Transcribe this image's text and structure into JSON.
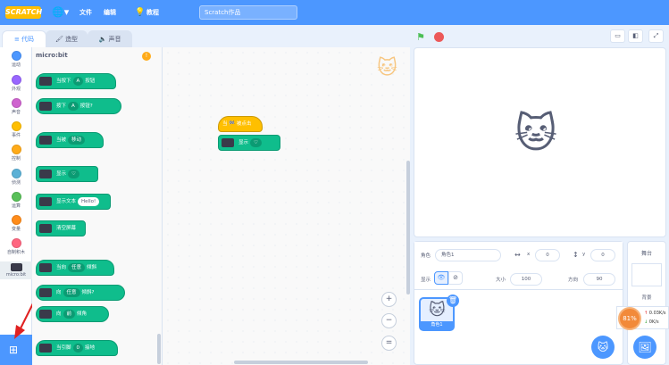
{
  "menubar": {
    "logo": "SCRATCH",
    "file": "文件",
    "edit": "编辑",
    "tutorials": "教程",
    "project_title": "Scratch作品"
  },
  "tabs": {
    "code": "代码",
    "costumes": "造型",
    "sounds": "声音"
  },
  "categories": [
    {
      "label": "运动",
      "color": "#4c97ff"
    },
    {
      "label": "外观",
      "color": "#9966ff"
    },
    {
      "label": "声音",
      "color": "#cf63cf"
    },
    {
      "label": "事件",
      "color": "#ffbf00"
    },
    {
      "label": "控制",
      "color": "#ffab19"
    },
    {
      "label": "侦测",
      "color": "#5cb1d6"
    },
    {
      "label": "运算",
      "color": "#59c059"
    },
    {
      "label": "变量",
      "color": "#ff8c1a"
    },
    {
      "label": "自制积木",
      "color": "#ff6680"
    },
    {
      "label": "micro:bit",
      "color": "#3a3a4a"
    }
  ],
  "palette": {
    "title": "micro:bit",
    "blocks": {
      "b1": {
        "pre": "当按下",
        "dd": "A",
        "post": "按钮"
      },
      "b2": {
        "pre": "按下",
        "dd": "A",
        "post": "按钮?"
      },
      "b3": {
        "pre": "当被",
        "dd": "移动"
      },
      "b4": {
        "pre": "显示",
        "dd": "♡"
      },
      "b5": {
        "pre": "显示文本",
        "pill": "Hello!"
      },
      "b6": {
        "pre": "清空屏幕"
      },
      "b7": {
        "pre": "当向",
        "dd": "任意",
        "post": "倾斜"
      },
      "b8": {
        "pre": "向",
        "dd": "任意",
        "post": "倾斜?"
      },
      "b9": {
        "pre": "向",
        "dd": "前",
        "post": "倾角"
      },
      "b10": {
        "pre": "当引脚",
        "dd": "0",
        "post": "接地"
      }
    }
  },
  "workspace": {
    "hat": "当 🏁 被点击",
    "show": "显示",
    "show_dd": "♡"
  },
  "sprite": {
    "name_label": "角色",
    "name_value": "角色1",
    "x_label": "x",
    "x_value": "0",
    "y_label": "y",
    "y_value": "0",
    "show_label": "显示",
    "size_label": "大小",
    "size_value": "100",
    "direction_label": "方向",
    "direction_value": "90",
    "thumb_label": "角色1"
  },
  "stage_panel": {
    "title": "舞台",
    "backdrops_label": "背景"
  },
  "net": {
    "percent": "81%",
    "up": "0.03K/s",
    "down": "0K/s"
  }
}
